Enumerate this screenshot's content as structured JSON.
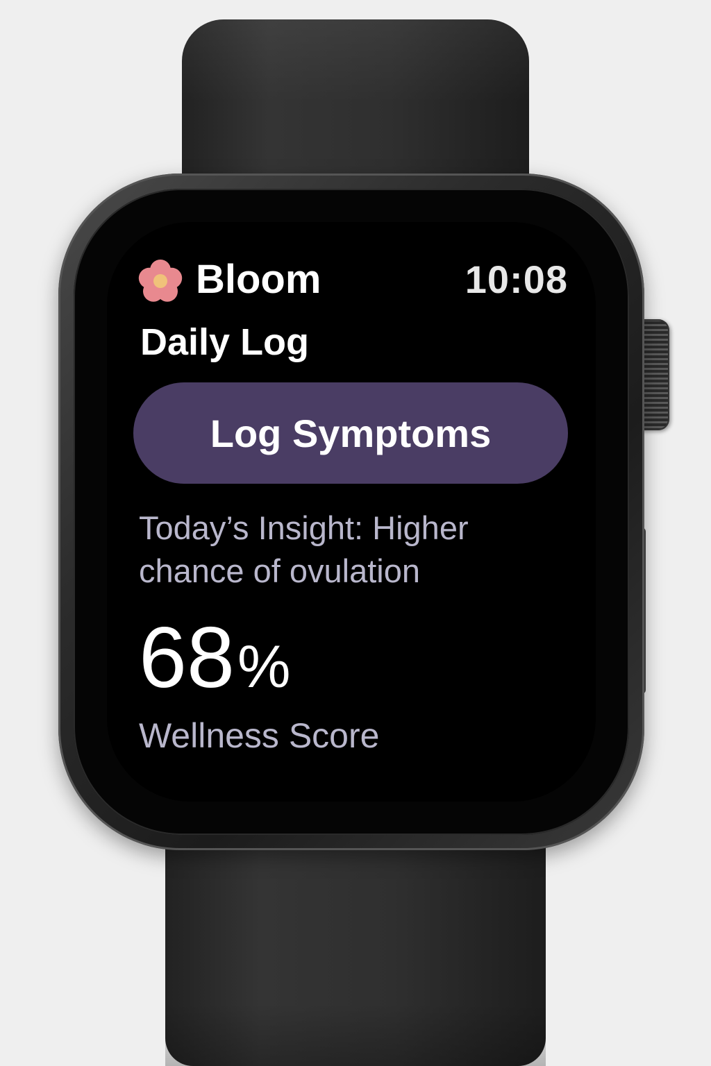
{
  "app": {
    "name": "Bloom",
    "logo_icon": "flower-icon",
    "logo_color": "#e8898f",
    "logo_center_color": "#f0c27a"
  },
  "status": {
    "time": "10:08"
  },
  "page": {
    "title": "Daily Log"
  },
  "actions": {
    "log_symptoms_label": "Log Symptoms",
    "button_color": "#4a3d64"
  },
  "insight": {
    "text": "Today’s Insight: Higher chance of ovulation"
  },
  "wellness": {
    "value": "68",
    "unit": "%",
    "label": "Wellness Score"
  }
}
